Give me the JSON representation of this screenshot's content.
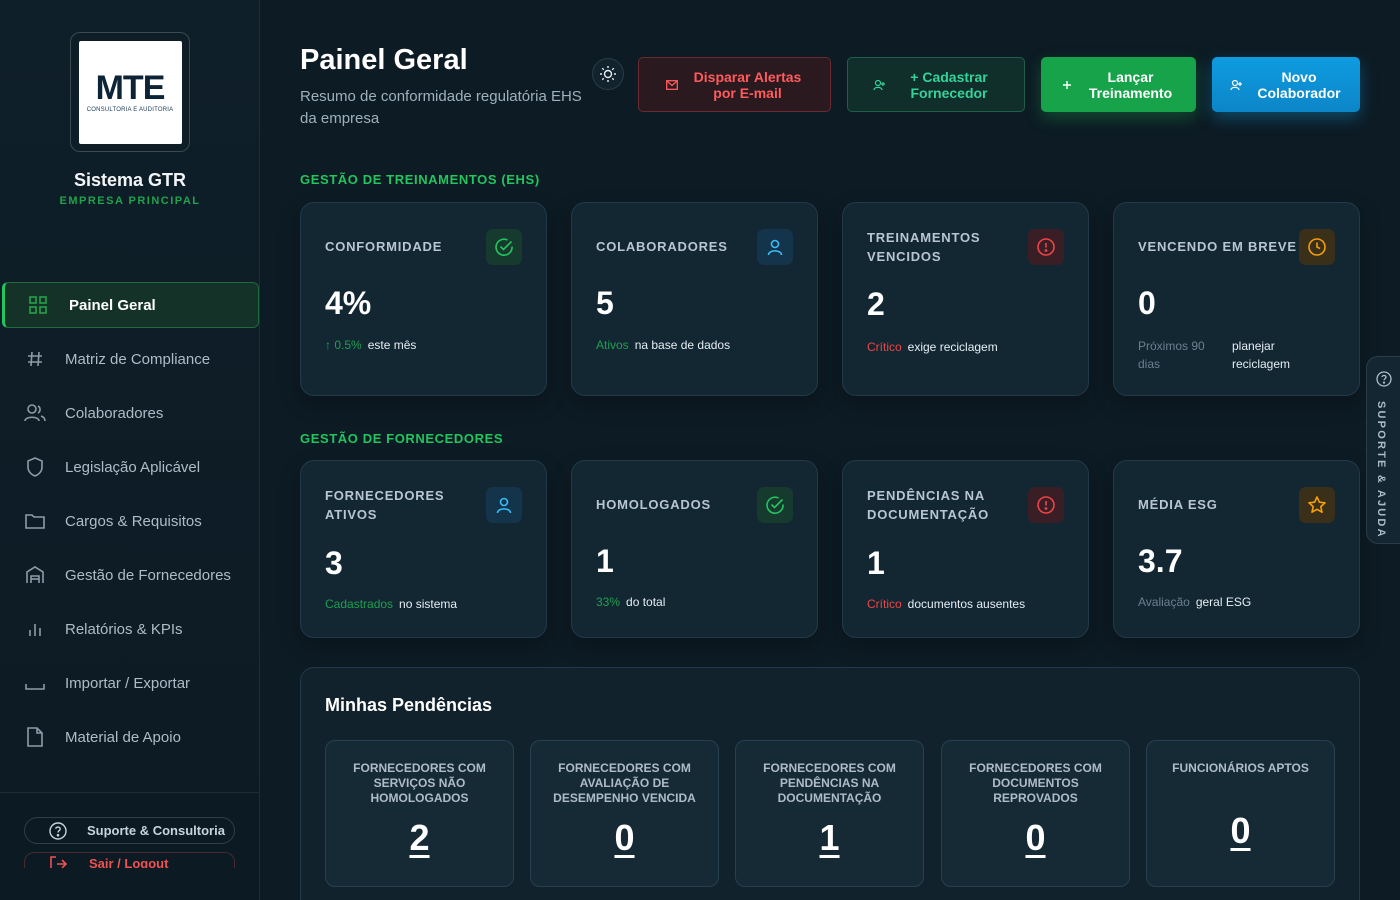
{
  "app": {
    "logo_text": "MTE",
    "logo_subtitle": "CONSULTORIA E AUDITORIA",
    "title": "Sistema GTR",
    "subtitle": "EMPRESA PRINCIPAL"
  },
  "nav": [
    {
      "label": "Painel Geral",
      "icon": "grid-icon",
      "active": true
    },
    {
      "label": "Matriz de Compliance",
      "icon": "hash-icon"
    },
    {
      "label": "Colaboradores",
      "icon": "users-icon"
    },
    {
      "label": "Legislação Aplicável",
      "icon": "shield-icon"
    },
    {
      "label": "Cargos & Requisitos",
      "icon": "folder-icon"
    },
    {
      "label": "Gestão de Fornecedores",
      "icon": "warehouse-icon"
    },
    {
      "label": "Relatórios & KPIs",
      "icon": "bar-chart-icon"
    },
    {
      "label": "Importar / Exportar",
      "icon": "tray-icon"
    },
    {
      "label": "Material de Apoio",
      "icon": "file-icon"
    }
  ],
  "footer": {
    "support": "Suporte & Consultoria",
    "logout": "Sair / Logout"
  },
  "header": {
    "title": "Painel Geral",
    "subtitle": "Resumo de conformidade regulatória EHS da empresa",
    "buttons": {
      "alert": "Disparar Alertas por E-mail",
      "supplier": "+ Cadastrar Fornecedor",
      "training": "Lançar Treinamento",
      "employee": "Novo Colaborador"
    }
  },
  "sections": {
    "training": "GESTÃO DE TREINAMENTOS (EHS)",
    "suppliers": "GESTÃO DE FORNECEDORES"
  },
  "training_cards": [
    {
      "label": "CONFORMIDADE",
      "value": "4%",
      "foot_a": "↑ 0.5%",
      "foot_b": "este mês",
      "icon": "check-circle-icon",
      "accent": "#22c55e"
    },
    {
      "label": "COLABORADORES",
      "value": "5",
      "foot_a": "Ativos",
      "foot_b": "na base de dados",
      "icon": "user-icon",
      "accent": "#38bdf8"
    },
    {
      "label": "TREINAMENTOS VENCIDOS",
      "value": "2",
      "foot_a": "Crítico",
      "foot_b": "exige reciclagem",
      "icon": "alert-circle-icon",
      "accent": "#ef4444"
    },
    {
      "label": "VENCENDO EM BREVE",
      "value": "0",
      "foot_a": "Próximos 90 dias",
      "foot_b": "planejar reciclagem",
      "icon": "clock-icon",
      "accent": "#f59e0b"
    }
  ],
  "supplier_cards": [
    {
      "label": "FORNECEDORES ATIVOS",
      "value": "3",
      "foot_a": "Cadastrados",
      "foot_b": "no sistema",
      "icon": "user-icon",
      "accent": "#38bdf8"
    },
    {
      "label": "HOMOLOGADOS",
      "value": "1",
      "foot_a": "33%",
      "foot_b": "do total",
      "icon": "check-circle-icon",
      "accent": "#22c55e"
    },
    {
      "label": "PENDÊNCIAS NA DOCUMENTAÇÃO",
      "value": "1",
      "foot_a": "Crítico",
      "foot_b": "documentos ausentes",
      "icon": "alert-circle-icon",
      "accent": "#ef4444"
    },
    {
      "label": "MÉDIA ESG",
      "value": "3.7",
      "foot_a": "Avaliação",
      "foot_b": "geral ESG",
      "icon": "star-icon",
      "accent": "#f59e0b"
    }
  ],
  "pendencias": {
    "title": "Minhas Pendências",
    "items": [
      {
        "label": "FORNECEDORES COM SERVIÇOS NÃO HOMOLOGADOS",
        "value": "2"
      },
      {
        "label": "FORNECEDORES COM AVALIAÇÃO DE DESEMPENHO VENCIDA",
        "value": "0"
      },
      {
        "label": "FORNECEDORES COM PENDÊNCIAS NA DOCUMENTAÇÃO",
        "value": "1"
      },
      {
        "label": "FORNECEDORES COM DOCUMENTOS REPROVADOS",
        "value": "0"
      },
      {
        "label": "FUNCIONÁRIOS APTOS",
        "value": "0"
      }
    ]
  },
  "side_tab": "SUPORTE & AJUDA",
  "colors": {
    "background": "#0d1b24",
    "brand_green": "#22c55e",
    "danger": "#ef4444",
    "info": "#0ea5e9"
  }
}
